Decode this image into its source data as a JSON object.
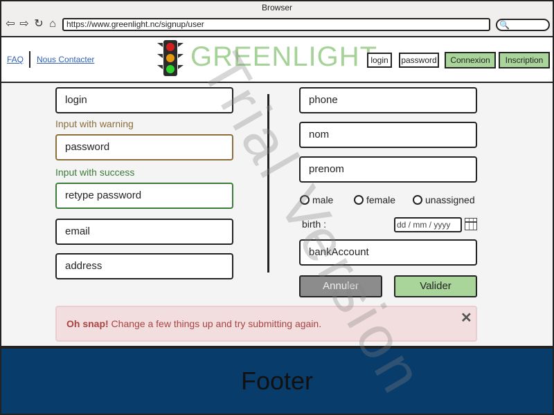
{
  "browser": {
    "title": "Browser",
    "url": "https://www.greenlight.nc/signup/user",
    "nav_icons": [
      "back-icon",
      "forward-icon",
      "refresh-icon",
      "home-icon"
    ]
  },
  "header": {
    "faq": "FAQ",
    "contact": "Nous Contacter",
    "brand": "GREENLIGHT",
    "login_placeholder": "login",
    "password_placeholder": "password",
    "connexion": "Connexion",
    "inscription": "Inscription"
  },
  "form_left": {
    "login": "login",
    "warning_label": "Input with warning",
    "password": "password",
    "success_label": "Input with success",
    "retype_password": "retype password",
    "email": "email",
    "address": "address"
  },
  "form_right": {
    "phone": "phone",
    "nom": "nom",
    "prenom": "prenom",
    "gender_options": [
      "male",
      "female",
      "unassigned"
    ],
    "birth_label": "birth :",
    "birth_placeholder": "dd / mm / yyyy",
    "bank_account": "bankAccount",
    "cancel": "Annuler",
    "submit": "Valider"
  },
  "alert": {
    "strong": "Oh snap!",
    "message": " Change a few things up and try submitting again.",
    "close": "✕"
  },
  "footer": {
    "text": "Footer"
  },
  "watermark": "Trial Version",
  "colors": {
    "brand_green": "#a5d297",
    "button_green": "#a9d59a",
    "footer_blue": "#083c6b",
    "alert_bg": "#f2dede",
    "alert_text": "#a94442",
    "warning": "#8a6d3b",
    "success": "#3c7a3c"
  }
}
